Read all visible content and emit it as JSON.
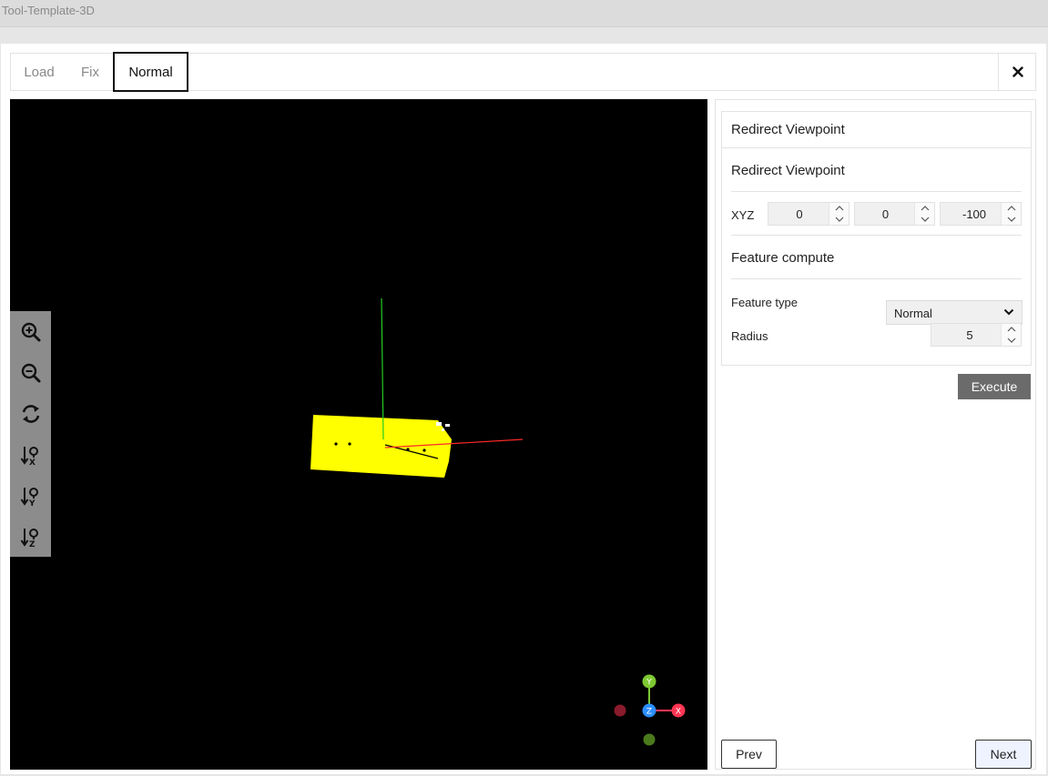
{
  "window": {
    "title": "Tool-Template-3D"
  },
  "tabs": [
    {
      "label": "Load",
      "active": false
    },
    {
      "label": "Fix",
      "active": false
    },
    {
      "label": "Normal",
      "active": true
    }
  ],
  "close_icon": "close-icon",
  "viewer": {
    "tools": [
      "zoom-in-icon",
      "zoom-out-icon",
      "reset-view-icon",
      "sort-x-icon",
      "sort-y-icon",
      "sort-z-icon"
    ],
    "gizmo": {
      "y": "Y",
      "z": "Z",
      "x": "X"
    },
    "colors": {
      "background": "#000000",
      "object": "#ffff00",
      "axis_x": "#ff2a2a",
      "axis_y": "#22cc22"
    }
  },
  "panel": {
    "card_header": "Redirect Viewpoint",
    "redirect_section": "Redirect Viewpoint",
    "xyz_label": "XYZ",
    "xyz_values": [
      "0",
      "0",
      "-100"
    ],
    "feature_section": "Feature compute",
    "feature_type_label": "Feature type",
    "feature_type_value": "Normal",
    "radius_label": "Radius",
    "radius_value": "5",
    "execute_label": "Execute",
    "prev_label": "Prev",
    "next_label": "Next"
  }
}
